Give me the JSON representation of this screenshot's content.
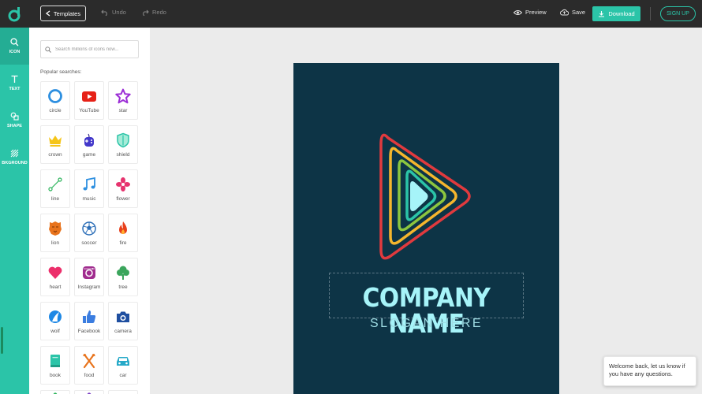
{
  "topbar": {
    "templates_label": "Templates",
    "undo_label": "Undo",
    "redo_label": "Redo",
    "preview_label": "Preview",
    "save_label": "Save",
    "download_label": "Download",
    "signup_label": "SIGN UP"
  },
  "rail": {
    "items": [
      {
        "label": "ICON",
        "icon": "search-icon"
      },
      {
        "label": "TEXT",
        "icon": "text-icon"
      },
      {
        "label": "SHAPE",
        "icon": "shape-icon"
      },
      {
        "label": "BKGROUND",
        "icon": "background-icon"
      }
    ]
  },
  "panel": {
    "search_placeholder": "Search millions of icons now...",
    "popular_label": "Popular searches:",
    "icons": [
      {
        "label": "circle",
        "icon": "circle-icon"
      },
      {
        "label": "YouTube",
        "icon": "youtube-icon"
      },
      {
        "label": "star",
        "icon": "star-icon"
      },
      {
        "label": "crown",
        "icon": "crown-icon"
      },
      {
        "label": "game",
        "icon": "gamepad-icon"
      },
      {
        "label": "shield",
        "icon": "shield-icon"
      },
      {
        "label": "line",
        "icon": "line-icon"
      },
      {
        "label": "music",
        "icon": "music-icon"
      },
      {
        "label": "flower",
        "icon": "flower-icon"
      },
      {
        "label": "lion",
        "icon": "lion-icon"
      },
      {
        "label": "soccer",
        "icon": "soccer-icon"
      },
      {
        "label": "fire",
        "icon": "fire-icon"
      },
      {
        "label": "heart",
        "icon": "heart-icon"
      },
      {
        "label": "Instagram",
        "icon": "instagram-icon"
      },
      {
        "label": "tree",
        "icon": "tree-icon"
      },
      {
        "label": "wolf",
        "icon": "wolf-icon"
      },
      {
        "label": "Facebook",
        "icon": "thumbs-up-icon"
      },
      {
        "label": "camera",
        "icon": "camera-icon"
      },
      {
        "label": "book",
        "icon": "book-icon"
      },
      {
        "label": "food",
        "icon": "fork-knife-icon"
      },
      {
        "label": "car",
        "icon": "car-icon"
      }
    ]
  },
  "canvas": {
    "company_name": "COMPANY NAME",
    "slogan": "SLOGAN HERE",
    "background": "#0d3446",
    "logo_colors": [
      "#e03a3e",
      "#f5b62d",
      "#8cc63f",
      "#2bc4a8",
      "#a6f4f9"
    ]
  },
  "chat": {
    "message": "Welcome back, let us know if you have any questions."
  },
  "colors": {
    "accent": "#2bc4a8",
    "topbar": "#2b2b2b"
  }
}
